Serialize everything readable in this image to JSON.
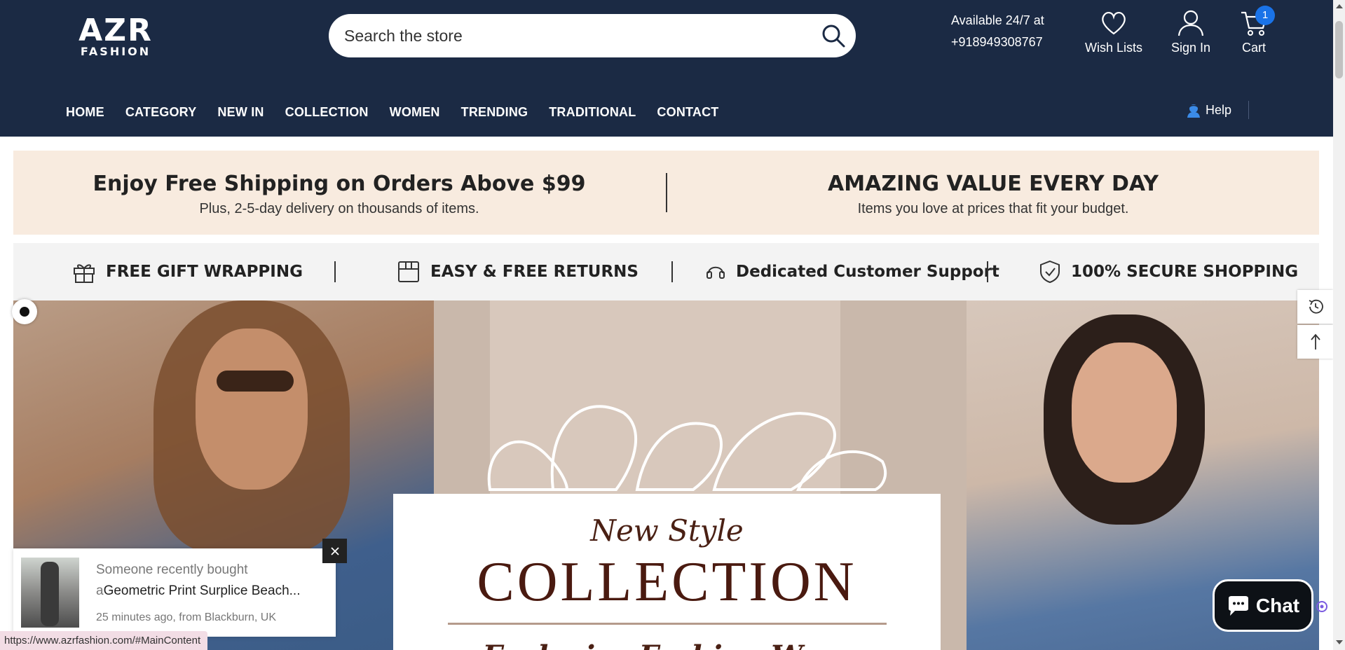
{
  "header": {
    "logo_top": "AZR",
    "logo_bottom": "FASHION",
    "search_placeholder": "Search the store",
    "availability_line1": "Available 24/7 at",
    "availability_line2": "+918949308767",
    "wishlist_label": "Wish Lists",
    "signin_label": "Sign In",
    "cart_label": "Cart",
    "cart_count": "1",
    "help_label": "Help"
  },
  "nav": {
    "items": [
      {
        "label": "HOME"
      },
      {
        "label": "CATEGORY"
      },
      {
        "label": "NEW IN"
      },
      {
        "label": "COLLECTION"
      },
      {
        "label": "WOMEN"
      },
      {
        "label": "TRENDING"
      },
      {
        "label": "TRADITIONAL"
      },
      {
        "label": "CONTACT"
      }
    ]
  },
  "promo": {
    "left_title": "Enjoy Free Shipping on Orders Above $99",
    "left_sub": "Plus, 2-5-day delivery on thousands of items.",
    "right_title": "AMAZING VALUE EVERY DAY",
    "right_sub": "Items you love at prices that fit your budget."
  },
  "features": {
    "items": [
      {
        "label": "FREE GIFT WRAPPING",
        "icon": "gift-icon"
      },
      {
        "label": "EASY & FREE RETURNS",
        "icon": "box-icon"
      },
      {
        "label": "Dedicated Customer Support",
        "icon": "headset-icon"
      },
      {
        "label": "100% SECURE SHOPPING",
        "icon": "shield-check-icon"
      }
    ]
  },
  "hero": {
    "line1": "New Style",
    "line2": "COLLECTION",
    "line3": "Exclusive Fashion Wear"
  },
  "toast": {
    "line1": "Someone recently bought",
    "prefix": "a",
    "product": "Geometric Print Surplice Beach...",
    "meta": "25 minutes ago, from Blackburn, UK"
  },
  "chat": {
    "label": "Chat"
  },
  "status_url": "https://www.azrfashion.com/#MainContent",
  "colors": {
    "header_bg": "#1b2a44",
    "promo_bg": "#f8ebdf",
    "feature_bg": "#f3f3f3",
    "badge": "#1a73e8"
  }
}
